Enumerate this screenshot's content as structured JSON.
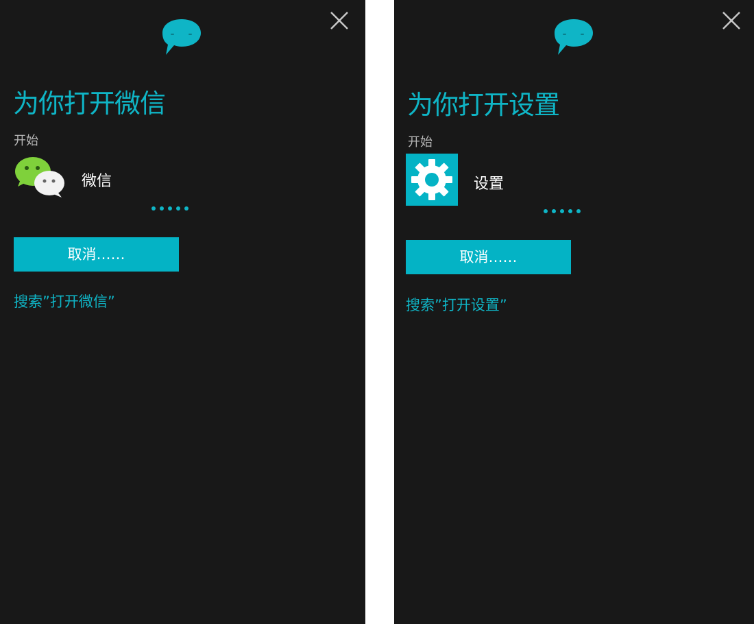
{
  "colors": {
    "accent": "#0fb5c6",
    "panel_background": "#181818",
    "separator": "#ffffff",
    "secondary_text": "#b8b8b8"
  },
  "panels": [
    {
      "heading": "为你打开微信",
      "section_label": "开始",
      "app_name": "微信",
      "app_icon": "wechat-icon",
      "cancel_label": "取消……",
      "search_link": "搜索”打开微信”"
    },
    {
      "heading": "为你打开设置",
      "section_label": "开始",
      "app_name": "设置",
      "app_icon": "settings-gear-icon",
      "cancel_label": "取消……",
      "search_link": "搜索”打开设置”"
    }
  ]
}
